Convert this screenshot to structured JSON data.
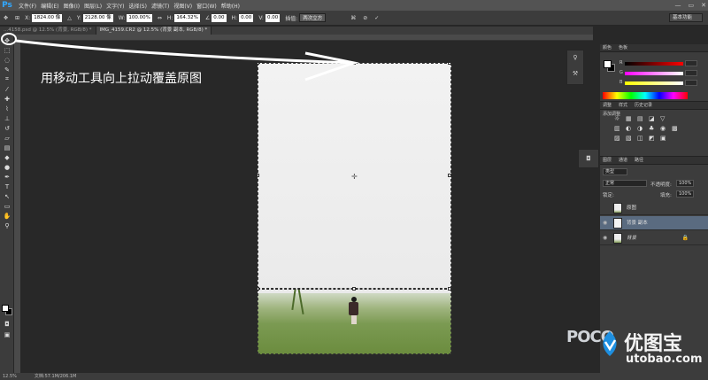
{
  "app": {
    "logo": "Ps"
  },
  "menu": [
    "文件(F)",
    "编辑(E)",
    "图像(I)",
    "图层(L)",
    "文字(Y)",
    "选择(S)",
    "滤镜(T)",
    "视图(V)",
    "窗口(W)",
    "帮助(H)"
  ],
  "window_controls": {
    "minimize": "—",
    "restore": "▭",
    "close": "✕"
  },
  "options": {
    "x_label": "X:",
    "x_value": "1824.00 像",
    "y_label": "Y:",
    "y_value": "2128.00 像",
    "w_label": "W:",
    "w_value": "100.00%",
    "h_label": "H:",
    "h_value": "164.32%",
    "angle_value": "0.00",
    "hskew_label": "H:",
    "hskew_value": "0.00",
    "vskew_label": "V:",
    "vskew_value": "0.00",
    "interp_label": "插值:",
    "interp_value": "两次立方",
    "workspace": "基本功能"
  },
  "tabs": [
    {
      "label": "...4158.psd @ 12.5% (背景, RGB/8) *",
      "active": false
    },
    {
      "label": "IMG_4159.CR2 @ 12.5% (背景 副本, RGB/8) *",
      "active": true
    }
  ],
  "annotation": {
    "text": "用移动工具向上拉动覆盖原图"
  },
  "panels": {
    "color_tabs": [
      "颜色",
      "色板"
    ],
    "channels": [
      "R",
      "G",
      "B"
    ],
    "adjust_tabs": [
      "调整",
      "样式",
      "历史记录"
    ],
    "adjust_title": "添加调整",
    "adjust_icons": [
      "☼",
      "▦",
      "▤",
      "◪",
      "▽",
      "▥",
      "◐",
      "◑",
      "♣",
      "◉",
      "▩",
      "▨",
      "▧",
      "◫",
      "◩",
      "▣"
    ],
    "layer_tabs": [
      "图层",
      "通道",
      "路径"
    ],
    "kind_label": "类型",
    "blend_mode": "正常",
    "opacity_label": "不透明度:",
    "opacity_value": "100%",
    "lock_label": "锁定:",
    "fill_label": "填充:",
    "fill_value": "100%",
    "layers": [
      {
        "name": "原图",
        "visible": false,
        "selected": false
      },
      {
        "name": "背景 副本",
        "visible": true,
        "selected": true
      },
      {
        "name": "背景",
        "visible": true,
        "selected": false,
        "locked": true
      }
    ]
  },
  "status": {
    "zoom": "12.5%",
    "doc": "文档:57.1M/206.1M"
  },
  "watermark": {
    "brand": "POCO",
    "site_cn": "优图宝",
    "site_url": "utobao.com"
  },
  "colors": {
    "accent_blue": "#31a8ff",
    "selected_layer": "#5a6b80",
    "annotation": "#ffffff"
  }
}
